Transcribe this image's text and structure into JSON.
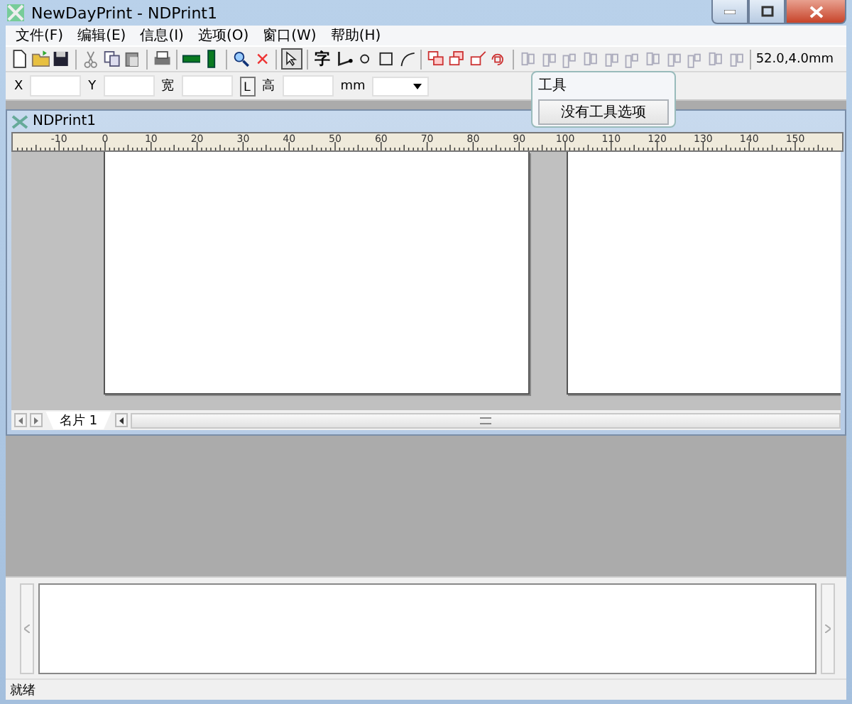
{
  "window": {
    "title": "NewDayPrint - NDPrint1"
  },
  "menu": [
    "文件(F)",
    "编辑(E)",
    "信息(I)",
    "选项(O)",
    "窗口(W)",
    "帮助(H)"
  ],
  "toolbar": {
    "text_tool": "字",
    "pointer_pressed": true,
    "coordinates": "52.0,4.0mm"
  },
  "properties_bar": {
    "labels": [
      {
        "kind": "label",
        "text": "X"
      },
      {
        "kind": "field"
      },
      {
        "kind": "label",
        "text": "Y"
      },
      {
        "kind": "field"
      },
      {
        "kind": "label",
        "text": "宽"
      },
      {
        "kind": "field"
      },
      {
        "kind": "lock",
        "text": "L"
      },
      {
        "kind": "label",
        "text": "高"
      },
      {
        "kind": "field"
      },
      {
        "kind": "label",
        "text": "mm"
      },
      {
        "kind": "dropdown"
      }
    ]
  },
  "tool_popup": {
    "title": "工具",
    "button": "没有工具选项"
  },
  "document": {
    "title": "NDPrint1",
    "ruler": [
      "-10",
      "0",
      "10",
      "20",
      "30",
      "40",
      "50",
      "60",
      "70",
      "80",
      "90",
      "100",
      "110",
      "120",
      "130",
      "140",
      "150"
    ],
    "sheet_tabs": [
      {
        "label": "名片 1",
        "selected": true
      }
    ]
  },
  "status_bar": "就绪"
}
